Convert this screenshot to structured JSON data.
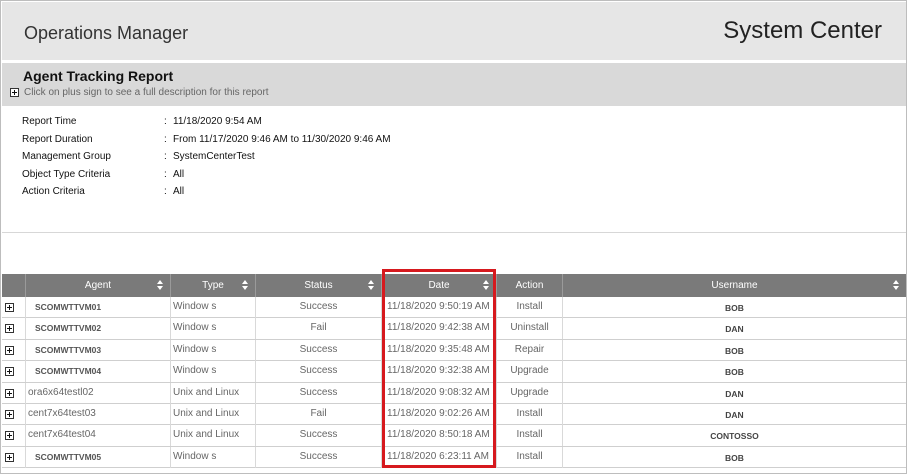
{
  "app": {
    "product": "Operations Manager",
    "brand": "System Center"
  },
  "report": {
    "title": "Agent Tracking Report",
    "hint": "Click on plus sign to see a full description for this report"
  },
  "params": [
    {
      "label": "Report Time",
      "value": "11/18/2020 9:54 AM"
    },
    {
      "label": "Report Duration",
      "value": "From 11/17/2020 9:46 AM to 11/30/2020 9:46 AM"
    },
    {
      "label": "Management Group",
      "value": "SystemCenterTest"
    },
    {
      "label": "Object Type Criteria",
      "value": "All"
    },
    {
      "label": "Action Criteria",
      "value": "All"
    }
  ],
  "table": {
    "columns": [
      "Agent",
      "Type",
      "Status",
      "Date",
      "Action",
      "Username"
    ],
    "rows": [
      {
        "agent": "SCOMWTTVM01",
        "type": "Window s",
        "status": "Success",
        "date": "11/18/2020 9:50:19 AM",
        "action": "Install",
        "username": "BOB"
      },
      {
        "agent": "SCOMWTTVM02",
        "type": "Window s",
        "status": "Fail",
        "date": "11/18/2020 9:42:38 AM",
        "action": "Uninstall",
        "username": "DAN"
      },
      {
        "agent": "SCOMWTTVM03",
        "type": "Window s",
        "status": "Success",
        "date": "11/18/2020 9:35:48 AM",
        "action": "Repair",
        "username": "BOB"
      },
      {
        "agent": "SCOMWTTVM04",
        "type": "Window s",
        "status": "Success",
        "date": "11/18/2020 9:32:38 AM",
        "action": "Upgrade",
        "username": "BOB"
      },
      {
        "agent": "ora6x64testl02",
        "type": "Unix and Linux",
        "status": "Success",
        "date": "11/18/2020 9:08:32 AM",
        "action": "Upgrade",
        "username": "DAN"
      },
      {
        "agent": "cent7x64test03",
        "type": "Unix and Linux",
        "status": "Fail",
        "date": "11/18/2020 9:02:26 AM",
        "action": "Install",
        "username": "DAN"
      },
      {
        "agent": "cent7x64test04",
        "type": "Unix and Linux",
        "status": "Success",
        "date": "11/18/2020 8:50:18 AM",
        "action": "Install",
        "username": "CONTOSSO"
      },
      {
        "agent": "SCOMWTTVM05",
        "type": "Window s",
        "status": "Success",
        "date": "11/18/2020 6:23:11 AM",
        "action": "Install",
        "username": "BOB"
      }
    ]
  },
  "colors": {
    "highlight": "#d6191e",
    "header_bg": "#7a7a7a",
    "banner_bg": "#e6e6e6"
  },
  "icons": {
    "expand": "plus-box-icon",
    "sort": "sort-arrows-icon"
  }
}
